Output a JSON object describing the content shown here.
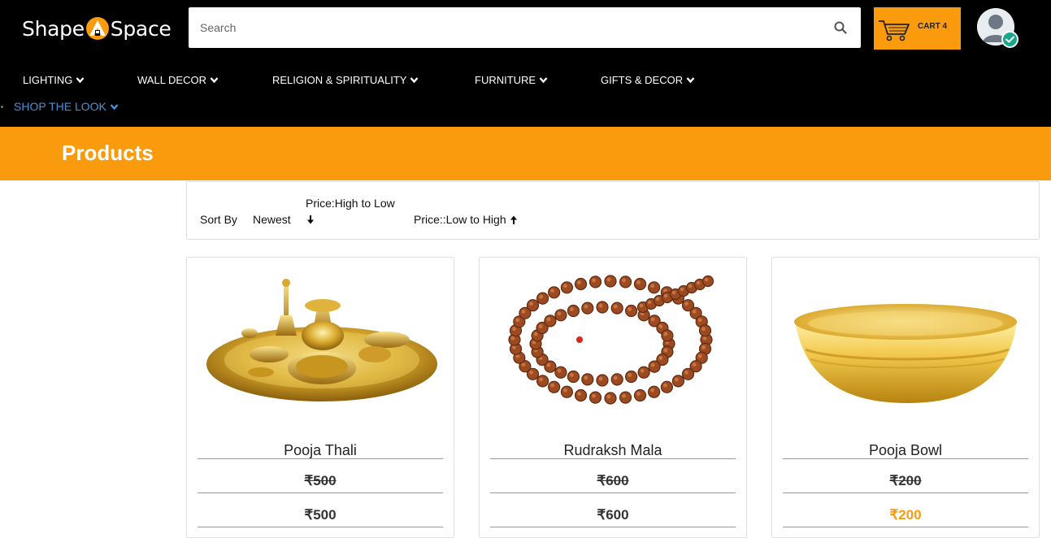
{
  "header": {
    "logo_left": "Shape",
    "logo_right": "Space",
    "search_placeholder": "Search",
    "cart_label": "CART 4"
  },
  "nav": {
    "items": [
      "LIGHTING",
      "WALL DECOR",
      "RELIGION & SPIRITUALITY",
      "FURNITURE",
      "GIFTS & DECOR",
      "SHOP THE LOOK"
    ]
  },
  "page": {
    "title": "Products"
  },
  "sort": {
    "label": "Sort By",
    "newest": "Newest",
    "high_to_low": "Price:High to Low",
    "low_to_high": "Price::Low to High"
  },
  "products": [
    {
      "name": "Pooja Thali",
      "old_price": "₹500",
      "price": "₹500",
      "image": "brass-pooja-thali-image"
    },
    {
      "name": "Rudraksh Mala",
      "old_price": "₹600",
      "price": "₹600",
      "image": "rudraksh-mala-image"
    },
    {
      "name": "Pooja Bowl",
      "old_price": "₹200",
      "price": "₹200",
      "image": "brass-pooja-bowl-image"
    }
  ],
  "colors": {
    "accent": "#f99b0c",
    "header_bg": "#000000",
    "nav_highlight": "#4a90d9",
    "verified_badge": "#1aa68a"
  },
  "icons": [
    "search-icon",
    "cart-icon",
    "user-avatar-icon",
    "verified-check-icon",
    "chevron-down-icon",
    "arrow-down-icon",
    "arrow-up-icon"
  ]
}
